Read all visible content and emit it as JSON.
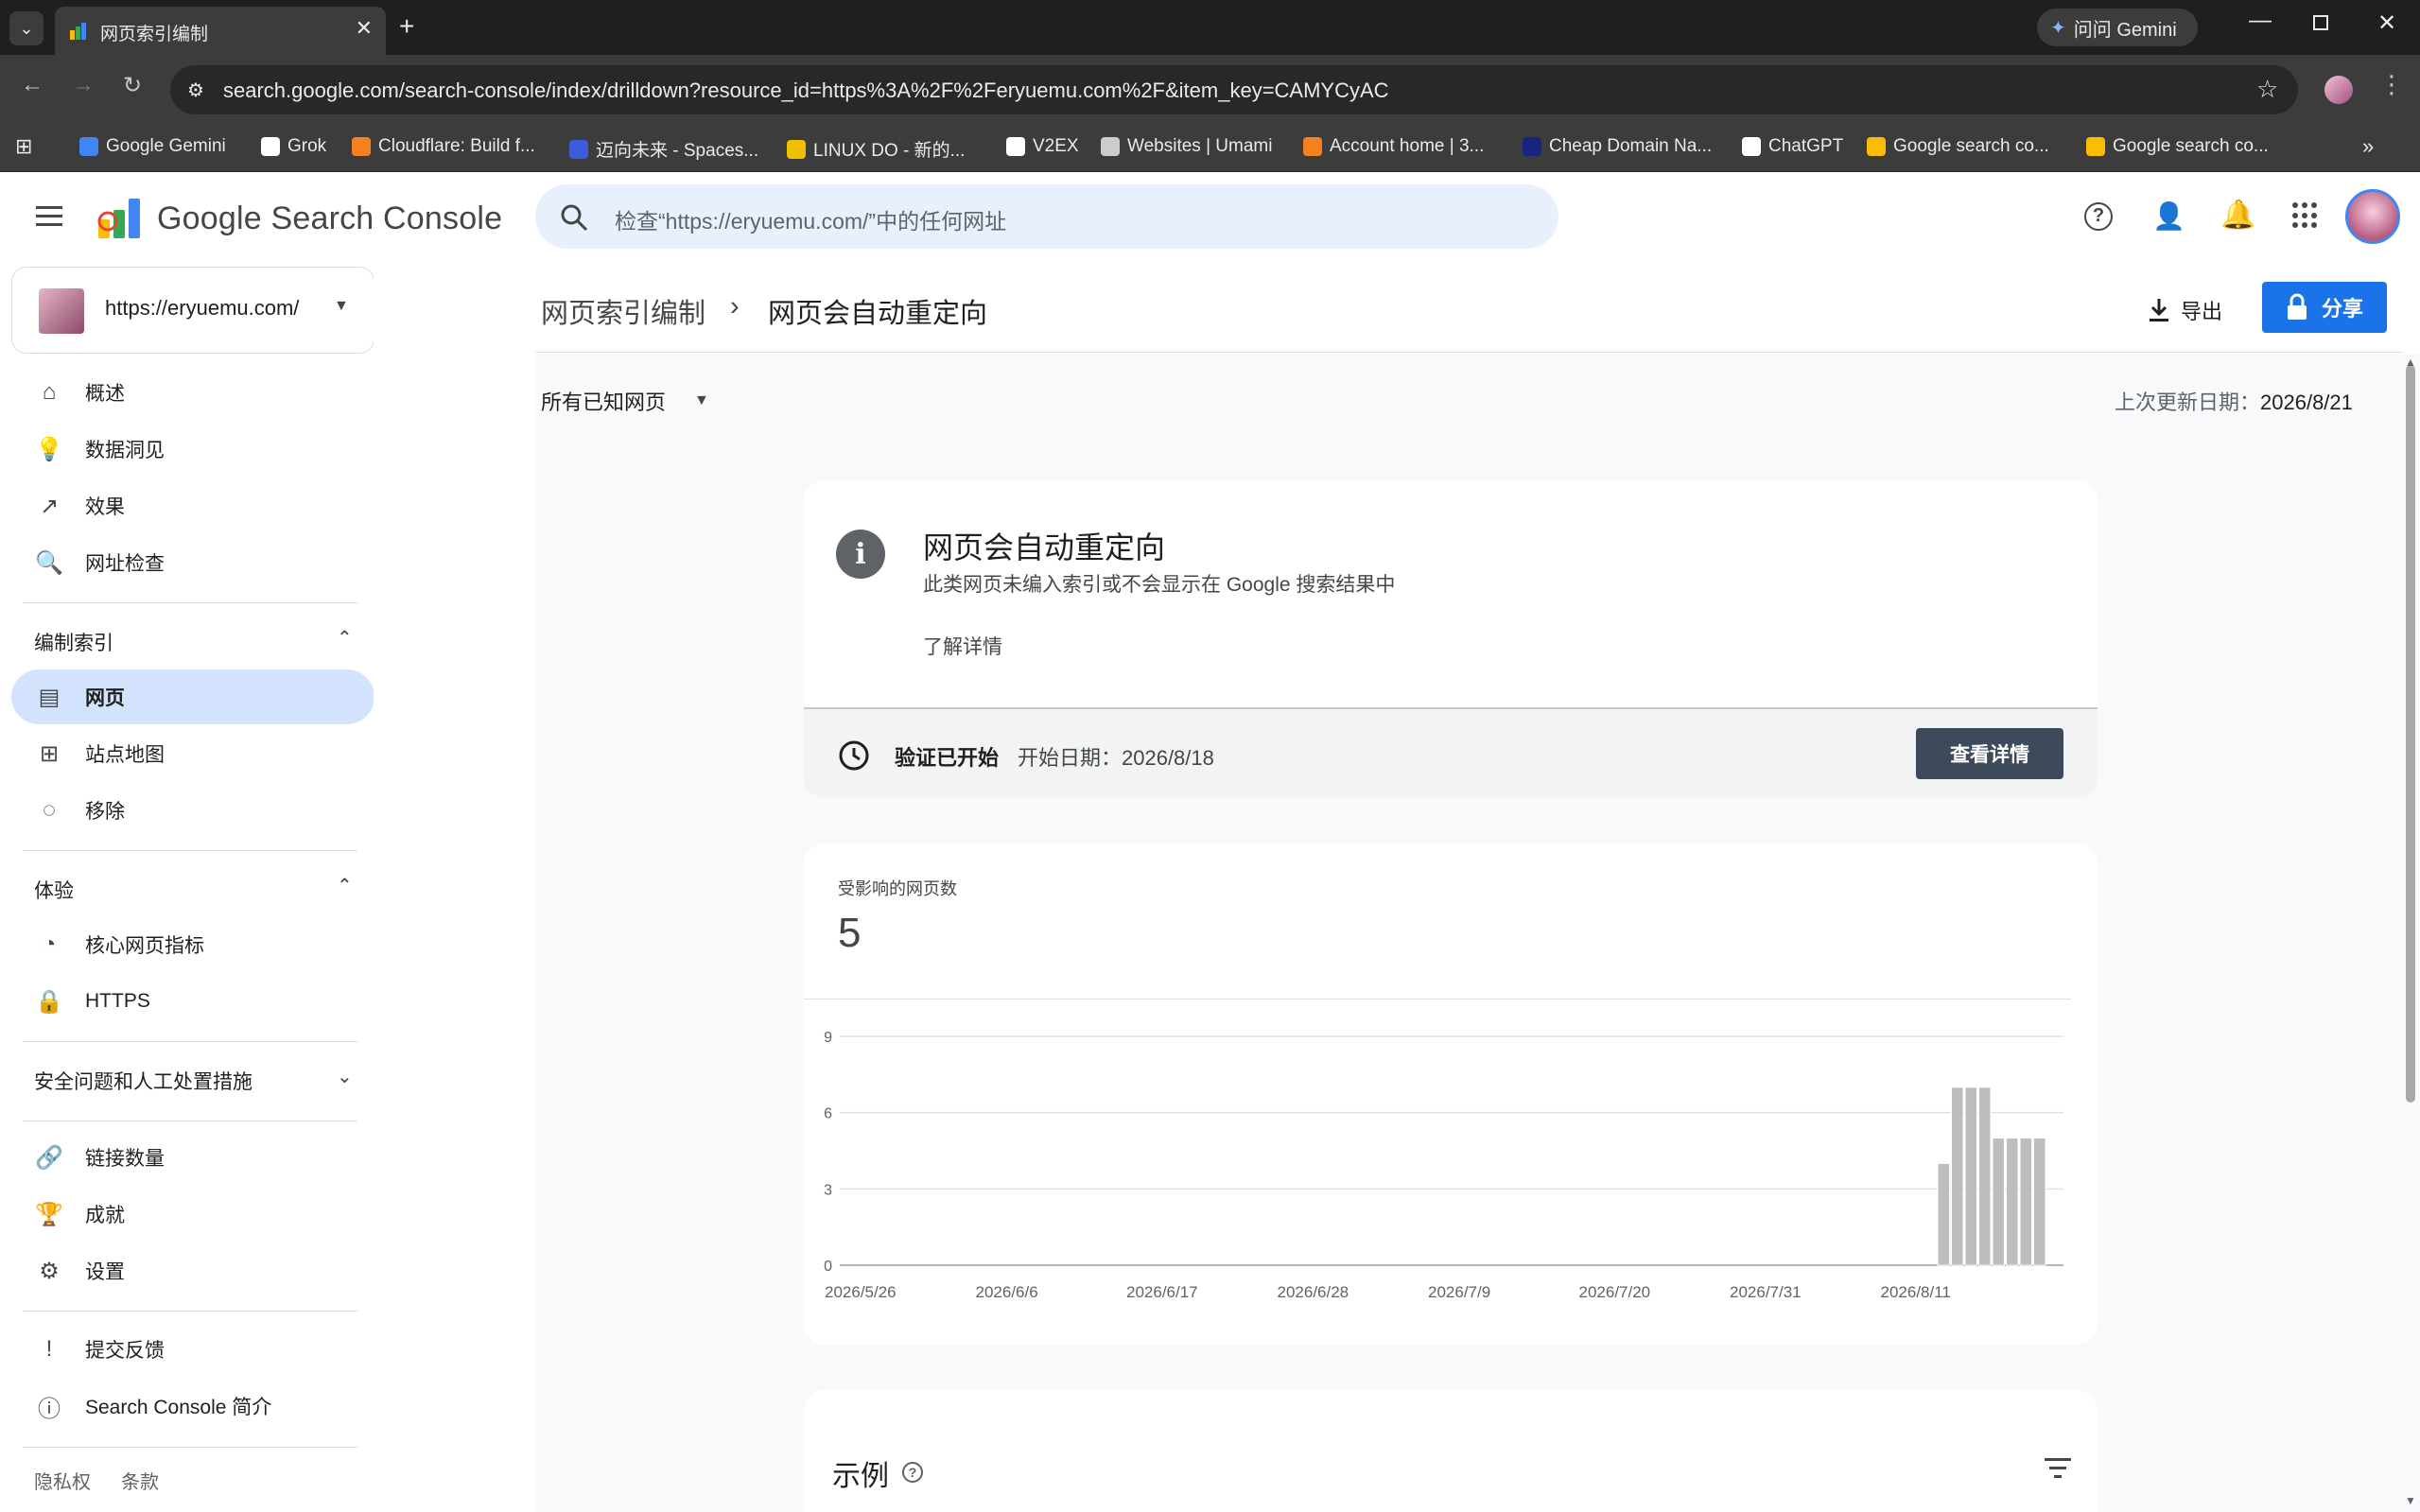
{
  "browser": {
    "tab_title": "网页索引编制",
    "gemini_button": "问问 Gemini",
    "url": "search.google.com/search-console/index/drilldown?resource_id=https%3A%2F%2Feryuemu.com%2F&item_key=CAMYCyAC",
    "bookmarks": [
      {
        "label": "Google Gemini",
        "color": "#4285f4"
      },
      {
        "label": "Grok",
        "color": "#ffffff"
      },
      {
        "label": "Cloudflare: Build f...",
        "color": "#f48120"
      },
      {
        "label": "迈向未来 - Spaces...",
        "color": "#3b5bdb"
      },
      {
        "label": "LINUX DO - 新的...",
        "color": "#f0c000"
      },
      {
        "label": "V2EX",
        "color": "#ffffff"
      },
      {
        "label": "Websites | Umami",
        "color": "#cccccc"
      },
      {
        "label": "Account home | 3...",
        "color": "#f48120"
      },
      {
        "label": "Cheap Domain Na...",
        "color": "#1a237e"
      },
      {
        "label": "ChatGPT",
        "color": "#ffffff"
      },
      {
        "label": "Google search co...",
        "color": "#fbbc04"
      },
      {
        "label": "Google search co...",
        "color": "#fbbc04"
      }
    ]
  },
  "app": {
    "brand": "Google Search Console",
    "search_placeholder": "检查“https://eryuemu.com/”中的任何网址",
    "property": "https://eryuemu.com/"
  },
  "sidebar": {
    "top_items": [
      {
        "label": "概述",
        "icon": "home-icon"
      },
      {
        "label": "数据洞见",
        "icon": "lightbulb-icon"
      },
      {
        "label": "效果",
        "icon": "trending-icon"
      },
      {
        "label": "网址检查",
        "icon": "search-icon"
      }
    ],
    "indexing_header": "编制索引",
    "indexing_items": [
      {
        "label": "网页",
        "icon": "pages-icon"
      },
      {
        "label": "站点地图",
        "icon": "sitemap-icon"
      },
      {
        "label": "移除",
        "icon": "visibility-off-icon"
      }
    ],
    "experience_header": "体验",
    "experience_items": [
      {
        "label": "核心网页指标",
        "icon": "speed-icon"
      },
      {
        "label": "HTTPS",
        "icon": "lock-icon"
      }
    ],
    "security_header": "安全问题和人工处置措施",
    "other_items": [
      {
        "label": "链接数量",
        "icon": "link-icon"
      },
      {
        "label": "成就",
        "icon": "trophy-icon"
      },
      {
        "label": "设置",
        "icon": "settings-icon"
      }
    ],
    "footer_items": [
      {
        "label": "提交反馈",
        "icon": "feedback-icon"
      },
      {
        "label": "Search Console 简介",
        "icon": "info-icon"
      }
    ],
    "privacy": "隐私权",
    "terms": "条款"
  },
  "main": {
    "breadcrumb_parent": "网页索引编制",
    "breadcrumb_current": "网页会自动重定向",
    "export_label": "导出",
    "share_label": "分享",
    "filter_label": "所有已知网页",
    "last_updated_label": "上次更新日期：",
    "last_updated_value": "2026/8/21",
    "issue_title": "网页会自动重定向",
    "issue_desc": "此类网页未编入索引或不会显示在 Google 搜索结果中",
    "learn_more": "了解详情",
    "validation_status": "验证已开始",
    "validation_start": "开始日期：2026/8/18",
    "view_details": "查看详情",
    "affected_label": "受影响的网页数",
    "affected_count": "5",
    "examples_title": "示例"
  },
  "chart_data": {
    "type": "bar",
    "title": "",
    "ylim": [
      0,
      9
    ],
    "yticks": [
      0,
      3,
      6,
      9
    ],
    "xticks": [
      "2026/5/26",
      "2026/6/6",
      "2026/6/17",
      "2026/6/28",
      "2026/7/9",
      "2026/7/20",
      "2026/7/31",
      "2026/8/11"
    ],
    "x_start": "2026/5/26",
    "x_end": "2026/8/21",
    "bar_color": "#bdbdbd",
    "series": [
      {
        "dates": [
          "2026/8/14",
          "2026/8/15",
          "2026/8/16",
          "2026/8/17",
          "2026/8/18",
          "2026/8/19",
          "2026/8/20",
          "2026/8/21"
        ],
        "values": [
          4,
          7,
          7,
          7,
          5,
          5,
          5,
          5
        ]
      }
    ]
  }
}
